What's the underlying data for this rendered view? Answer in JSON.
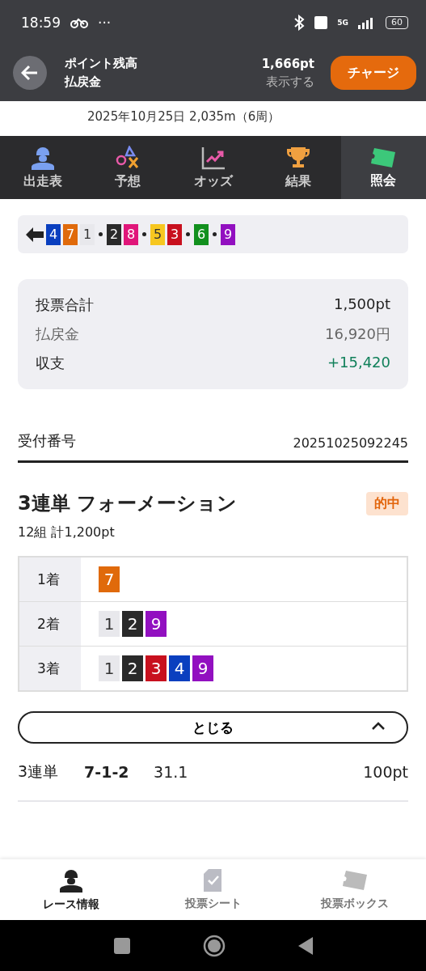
{
  "status_bar": {
    "time": "18:59",
    "more": "···",
    "network": "5G",
    "battery": "60"
  },
  "header": {
    "balance_label": "ポイント残高",
    "balance_value": "1,666pt",
    "payout_label": "払戻金",
    "payout_value": "表示する",
    "charge_button": "チャージ"
  },
  "race_info": "2025年10月25日 2,035m（6周）",
  "tabs": [
    {
      "label": "出走表",
      "selected": false
    },
    {
      "label": "予想",
      "selected": false
    },
    {
      "label": "オッズ",
      "selected": false
    },
    {
      "label": "結果",
      "selected": false
    },
    {
      "label": "照会",
      "selected": true
    }
  ],
  "trace": {
    "groups": [
      [
        {
          "n": "4",
          "color": "#0a3fbf"
        },
        {
          "n": "7",
          "color": "#e06a0b"
        },
        {
          "n": "1",
          "color": "#e8e8ec"
        }
      ],
      [
        {
          "n": "2",
          "color": "#2a2a2a"
        },
        {
          "n": "8",
          "color": "#e0167a"
        }
      ],
      [
        {
          "n": "5",
          "color": "#f7c720"
        },
        {
          "n": "3",
          "color": "#c8101e"
        }
      ],
      [
        {
          "n": "6",
          "color": "#12901e"
        }
      ],
      [
        {
          "n": "9",
          "color": "#9210c0"
        }
      ]
    ]
  },
  "summary": [
    {
      "label": "投票合計",
      "value": "1,500pt",
      "kind": "total"
    },
    {
      "label": "払戻金",
      "value": "16,920円",
      "kind": "muted"
    },
    {
      "label": "収支",
      "value": "+15,420",
      "kind": "profit"
    }
  ],
  "receipt": {
    "label": "受付番号",
    "value": "20251025092245"
  },
  "bet": {
    "title": "3連単 フォーメーション",
    "badge": "的中",
    "subtitle": "12組 計1,200pt",
    "positions": [
      {
        "label": "1着",
        "boats": [
          {
            "n": "7",
            "color": "#e06a0b"
          }
        ]
      },
      {
        "label": "2着",
        "boats": [
          {
            "n": "1",
            "color": "#e8e8ec"
          },
          {
            "n": "2",
            "color": "#2a2a2a"
          },
          {
            "n": "9",
            "color": "#9210c0"
          }
        ]
      },
      {
        "label": "3着",
        "boats": [
          {
            "n": "1",
            "color": "#e8e8ec"
          },
          {
            "n": "2",
            "color": "#2a2a2a"
          },
          {
            "n": "3",
            "color": "#c8101e"
          },
          {
            "n": "4",
            "color": "#0a3fbf"
          },
          {
            "n": "9",
            "color": "#9210c0"
          }
        ]
      }
    ],
    "close_button": "とじる",
    "rows": [
      {
        "type": "3連単",
        "combo": "7-1-2",
        "odds": "31.1",
        "amount": "100pt"
      }
    ]
  },
  "bottom_nav": [
    {
      "label": "レース情報",
      "selected": true
    },
    {
      "label": "投票シート",
      "selected": false
    },
    {
      "label": "投票ボックス",
      "selected": false
    }
  ]
}
